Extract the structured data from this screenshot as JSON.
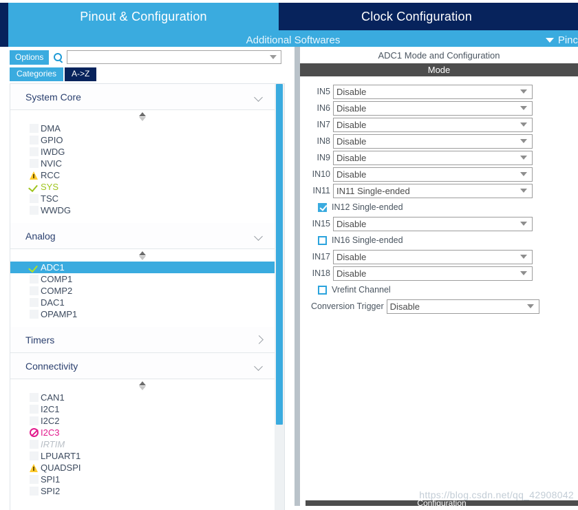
{
  "header": {
    "tabs": [
      {
        "label": "Pinout & Configuration",
        "active": true
      },
      {
        "label": "Clock Configuration",
        "active": false
      }
    ],
    "additional_softwares": "Additional Softwares",
    "pinout_menu": "Pinc",
    "colors": {
      "active_tab": "#3aabdf",
      "inactive_tab": "#07235c"
    }
  },
  "left_panel": {
    "options_button": "Options",
    "search": {
      "value": "",
      "placeholder": ""
    },
    "view_tabs": [
      {
        "label": "Categories",
        "selected": true
      },
      {
        "label": "A->Z",
        "selected": false
      }
    ],
    "groups": [
      {
        "name": "System Core",
        "expanded": true,
        "items": [
          {
            "label": "DMA",
            "status": "none"
          },
          {
            "label": "GPIO",
            "status": "none"
          },
          {
            "label": "IWDG",
            "status": "none"
          },
          {
            "label": "NVIC",
            "status": "none"
          },
          {
            "label": "RCC",
            "status": "warning"
          },
          {
            "label": "SYS",
            "status": "ok"
          },
          {
            "label": "TSC",
            "status": "none"
          },
          {
            "label": "WWDG",
            "status": "none"
          }
        ]
      },
      {
        "name": "Analog",
        "expanded": true,
        "items": [
          {
            "label": "ADC1",
            "status": "ok",
            "selected": true
          },
          {
            "label": "COMP1",
            "status": "none"
          },
          {
            "label": "COMP2",
            "status": "none"
          },
          {
            "label": "DAC1",
            "status": "none"
          },
          {
            "label": "OPAMP1",
            "status": "none"
          }
        ]
      },
      {
        "name": "Timers",
        "expanded": false,
        "items": []
      },
      {
        "name": "Connectivity",
        "expanded": true,
        "items": [
          {
            "label": "CAN1",
            "status": "none"
          },
          {
            "label": "I2C1",
            "status": "none"
          },
          {
            "label": "I2C2",
            "status": "none"
          },
          {
            "label": "I2C3",
            "status": "forbidden"
          },
          {
            "label": "IRTIM",
            "status": "none",
            "disabled": true
          },
          {
            "label": "LPUART1",
            "status": "none"
          },
          {
            "label": "QUADSPI",
            "status": "warning"
          },
          {
            "label": "SPI1",
            "status": "none"
          },
          {
            "label": "SPI2",
            "status": "none"
          }
        ]
      }
    ]
  },
  "right_panel": {
    "title": "ADC1 Mode and Configuration",
    "mode_bar": "Mode",
    "rows": [
      {
        "kind": "select",
        "label": "IN5",
        "value": "Disable"
      },
      {
        "kind": "select",
        "label": "IN6",
        "value": "Disable"
      },
      {
        "kind": "select",
        "label": "IN7",
        "value": "Disable"
      },
      {
        "kind": "select",
        "label": "IN8",
        "value": "Disable"
      },
      {
        "kind": "select",
        "label": "IN9",
        "value": "Disable"
      },
      {
        "kind": "select",
        "label": "IN10",
        "value": "Disable"
      },
      {
        "kind": "select",
        "label": "IN11",
        "value": "IN11 Single-ended"
      },
      {
        "kind": "checkbox",
        "label": "IN12 Single-ended",
        "checked": true
      },
      {
        "kind": "select",
        "label": "IN15",
        "value": "Disable"
      },
      {
        "kind": "checkbox",
        "label": "IN16 Single-ended",
        "checked": false
      },
      {
        "kind": "select",
        "label": "IN17",
        "value": "Disable"
      },
      {
        "kind": "select",
        "label": "IN18",
        "value": "Disable"
      },
      {
        "kind": "checkbox",
        "label": "Vrefint Channel",
        "checked": false
      },
      {
        "kind": "select-wide-label",
        "label": "Conversion Trigger",
        "value": "Disable"
      }
    ],
    "bottom_section": "Configuration"
  },
  "watermark": "https://blog.csdn.net/qq_42908042"
}
